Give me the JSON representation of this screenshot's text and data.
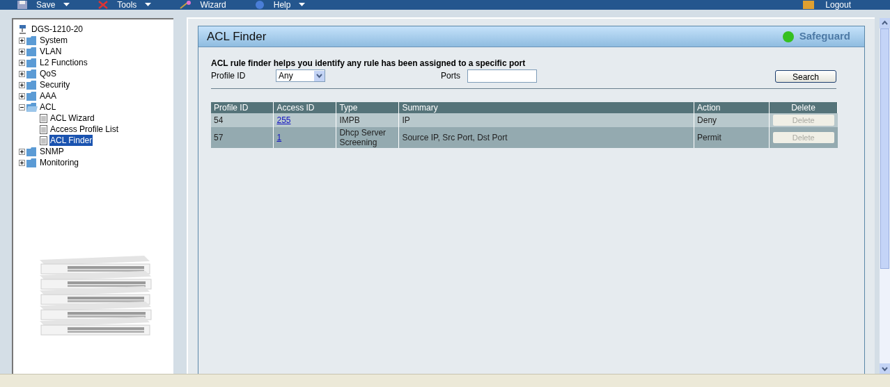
{
  "menu": [
    {
      "label": "Save",
      "dropdown": true
    },
    {
      "label": "Tools",
      "dropdown": true
    },
    {
      "label": "Wizard",
      "dropdown": false
    },
    {
      "label": "Help",
      "dropdown": true
    }
  ],
  "logout": "Logout",
  "tree": {
    "root": "DGS-1210-20",
    "items": [
      {
        "label": "System",
        "expanded": false,
        "selected": false
      },
      {
        "label": "VLAN",
        "expanded": false,
        "selected": false
      },
      {
        "label": "L2 Functions",
        "expanded": false,
        "selected": false
      },
      {
        "label": "QoS",
        "expanded": false,
        "selected": false
      },
      {
        "label": "Security",
        "expanded": false,
        "selected": false
      },
      {
        "label": "AAA",
        "expanded": false,
        "selected": false
      },
      {
        "label": "ACL",
        "expanded": true,
        "selected": false,
        "children": [
          {
            "label": "ACL Wizard",
            "selected": false
          },
          {
            "label": "Access Profile List",
            "selected": false
          },
          {
            "label": "ACL Finder",
            "selected": true
          }
        ]
      },
      {
        "label": "SNMP",
        "expanded": false,
        "selected": false
      },
      {
        "label": "Monitoring",
        "expanded": false,
        "selected": false
      }
    ]
  },
  "panel": {
    "title": "ACL Finder",
    "safeguard": "Safeguard",
    "description": "ACL rule finder helps you identify any rule has been assigned to a specific port",
    "profile_label": "Profile ID",
    "profile_value": "Any",
    "ports_label": "Ports",
    "search_button": "Search",
    "table": {
      "columns": [
        "Profile ID",
        "Access ID",
        "Type",
        "Summary",
        "Action",
        "Delete"
      ],
      "rows": [
        {
          "profile_id": "54",
          "access_id": "255",
          "type": "IMPB",
          "summary": "IP",
          "action": "Deny",
          "delete": "Delete",
          "disabled": true
        },
        {
          "profile_id": "57",
          "access_id": "1",
          "type": "Dhcp Server Screening",
          "summary": "Source IP, Src Port, Dst Port",
          "action": "Permit",
          "delete": "Delete",
          "disabled": true
        }
      ]
    }
  }
}
